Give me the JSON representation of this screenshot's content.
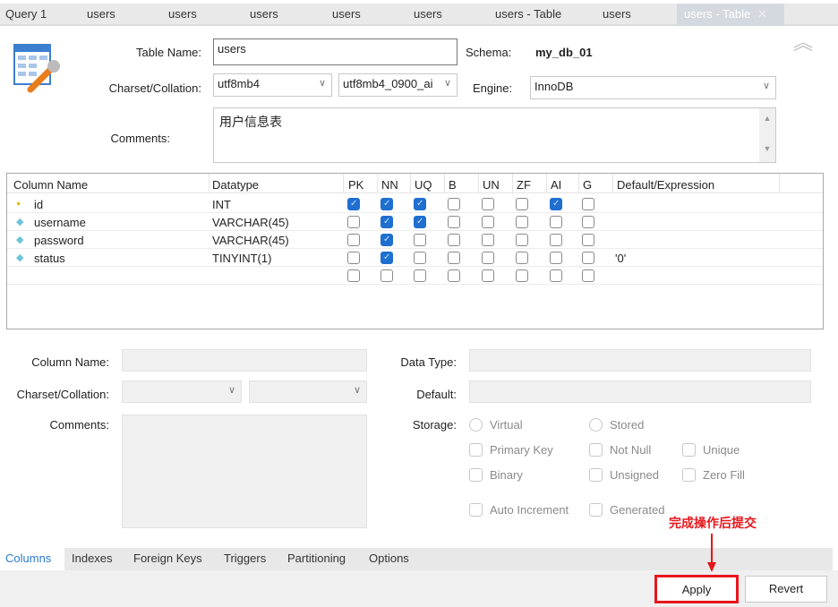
{
  "tabs": [
    {
      "label": "Query 1"
    },
    {
      "label": "users"
    },
    {
      "label": "users"
    },
    {
      "label": "users"
    },
    {
      "label": "users"
    },
    {
      "label": "users"
    },
    {
      "label": "users - Table"
    },
    {
      "label": "users"
    },
    {
      "label": "users - Table",
      "active": true
    }
  ],
  "form": {
    "table_name_label": "Table Name:",
    "table_name": "users",
    "schema_label": "Schema:",
    "schema": "my_db_01",
    "charset_label": "Charset/Collation:",
    "charset": "utf8mb4",
    "collation": "utf8mb4_0900_ai",
    "engine_label": "Engine:",
    "engine": "InnoDB",
    "comments_label": "Comments:",
    "comments": "用户信息表"
  },
  "grid": {
    "headers": [
      "Column Name",
      "Datatype",
      "PK",
      "NN",
      "UQ",
      "B",
      "UN",
      "ZF",
      "AI",
      "G",
      "Default/Expression"
    ],
    "rows": [
      {
        "name": "id",
        "icon": "primary-key-icon",
        "type": "INT",
        "flags": [
          1,
          1,
          1,
          0,
          0,
          0,
          1,
          0
        ],
        "default": ""
      },
      {
        "name": "username",
        "icon": "column-diamond-icon",
        "type": "VARCHAR(45)",
        "flags": [
          0,
          1,
          1,
          0,
          0,
          0,
          0,
          0
        ],
        "default": ""
      },
      {
        "name": "password",
        "icon": "column-diamond-icon",
        "type": "VARCHAR(45)",
        "flags": [
          0,
          1,
          0,
          0,
          0,
          0,
          0,
          0
        ],
        "default": ""
      },
      {
        "name": "status",
        "icon": "column-diamond-icon",
        "type": "TINYINT(1)",
        "flags": [
          0,
          1,
          0,
          0,
          0,
          0,
          0,
          0
        ],
        "default": "'0'"
      },
      {
        "name": "",
        "icon": "",
        "type": "",
        "flags": [
          0,
          0,
          0,
          0,
          0,
          0,
          0,
          0
        ],
        "default": ""
      }
    ]
  },
  "detail": {
    "column_name_label": "Column Name:",
    "charset_label": "Charset/Collation:",
    "comments_label": "Comments:",
    "data_type_label": "Data Type:",
    "default_label": "Default:",
    "storage_label": "Storage:",
    "virtual": "Virtual",
    "stored": "Stored",
    "primary_key": "Primary Key",
    "not_null": "Not Null",
    "unique": "Unique",
    "binary": "Binary",
    "unsigned": "Unsigned",
    "zero_fill": "Zero Fill",
    "auto_increment": "Auto Increment",
    "generated": "Generated"
  },
  "bottom_tabs": [
    "Columns",
    "Indexes",
    "Foreign Keys",
    "Triggers",
    "Partitioning",
    "Options"
  ],
  "annotation": {
    "text": "完成操作后提交",
    "color": "#e8161b"
  },
  "buttons": {
    "apply": "Apply",
    "revert": "Revert"
  }
}
